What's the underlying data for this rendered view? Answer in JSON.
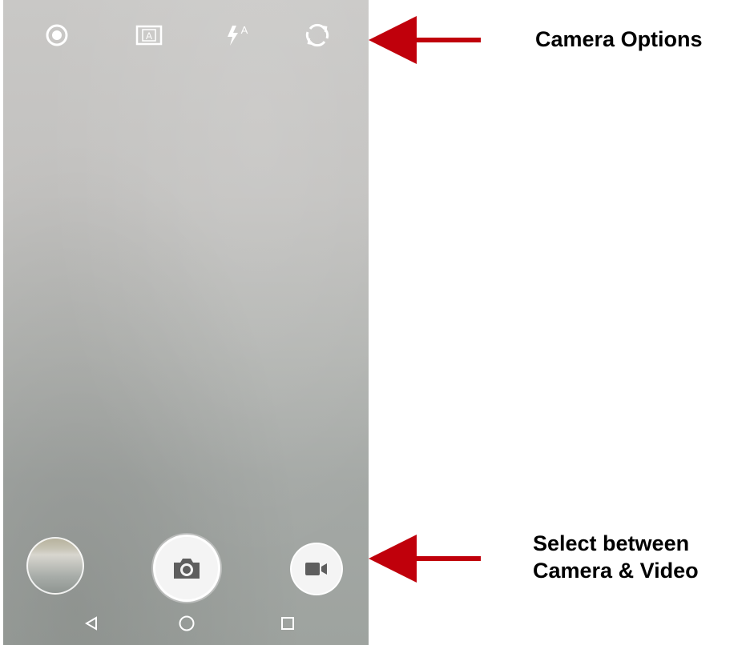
{
  "camera_ui": {
    "top_options": {
      "settings_icon": "settings-icon",
      "mode_icon": "auto-mode-icon",
      "mode_letter": "A",
      "flash_icon": "flash-auto-icon",
      "flash_letter": "A",
      "switch_camera_icon": "switch-camera-icon"
    },
    "bottom_controls": {
      "gallery_thumbnail": "gallery-thumbnail",
      "shutter_icon": "camera-icon",
      "video_icon": "video-camera-icon"
    },
    "navigation": {
      "back_icon": "back-triangle-icon",
      "home_icon": "home-circle-icon",
      "recents_icon": "recents-square-icon"
    }
  },
  "annotations": {
    "top_label": "Camera Options",
    "bottom_label_line1": "Select between",
    "bottom_label_line2": "Camera & Video",
    "arrow_color": "#c0000b"
  }
}
